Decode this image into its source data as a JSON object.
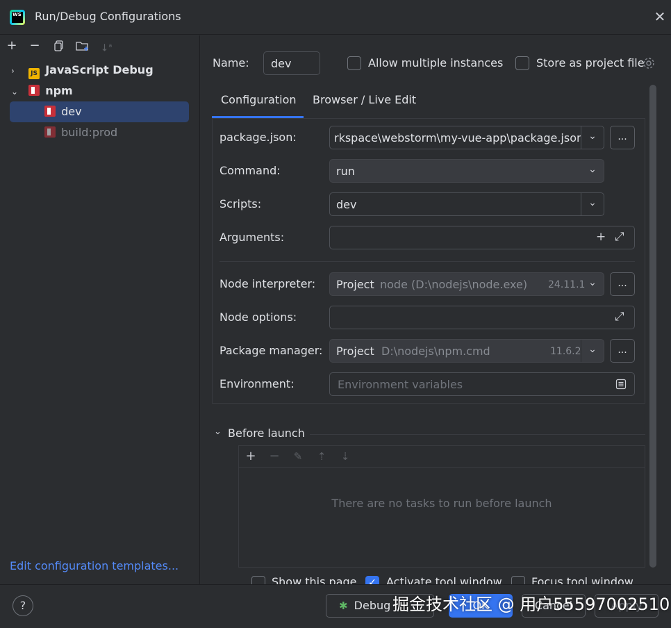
{
  "window": {
    "title": "Run/Debug Configurations",
    "app_icon_text": "WS"
  },
  "left_toolbar": {
    "add_icon": "+",
    "remove_icon": "−",
    "copy_icon": "copy-icon",
    "folder_icon": "folder-add-icon",
    "sort_icon": "sort-icon"
  },
  "tree": {
    "groups": [
      {
        "label": "JavaScript Debug",
        "badge": "JS",
        "expanded": false
      },
      {
        "label": "npm",
        "expanded": true,
        "children": [
          {
            "label": "dev",
            "selected": true
          },
          {
            "label": "build:prod",
            "selected": false
          }
        ]
      }
    ]
  },
  "edit_templates_link": "Edit configuration templates...",
  "header": {
    "name_label": "Name:",
    "name_value": "dev",
    "allow_multiple_label": "Allow multiple instances",
    "allow_multiple_checked": false,
    "store_project_label": "Store as project file",
    "store_project_checked": false
  },
  "tabs": [
    {
      "label": "Configuration",
      "active": true
    },
    {
      "label": "Browser / Live Edit",
      "active": false
    }
  ],
  "form": {
    "package_json_label": "package.json:",
    "package_json_value": "rkspace\\webstorm\\my-vue-app\\package.json",
    "command_label": "Command:",
    "command_value": "run",
    "scripts_label": "Scripts:",
    "scripts_value": "dev",
    "arguments_label": "Arguments:",
    "arguments_value": "",
    "node_interpreter_label": "Node interpreter:",
    "node_interpreter_prefix": "Project",
    "node_interpreter_path": "node (D:\\nodejs\\node.exe)",
    "node_interpreter_version": "24.11.1",
    "node_options_label": "Node options:",
    "node_options_value": "",
    "package_manager_label": "Package manager:",
    "package_manager_prefix": "Project",
    "package_manager_path": "D:\\nodejs\\npm.cmd",
    "package_manager_version": "11.6.2",
    "environment_label": "Environment:",
    "environment_placeholder": "Environment variables",
    "dots": "..."
  },
  "before_launch": {
    "title": "Before launch",
    "empty_text": "There are no tasks to run before launch"
  },
  "options": [
    {
      "label": "Show this page",
      "checked": false
    },
    {
      "label": "Activate tool window",
      "checked": true
    },
    {
      "label": "Focus tool window",
      "checked": false
    }
  ],
  "buttons": {
    "debug": "Debug",
    "ok": "OK",
    "cancel": "Cancel",
    "apply": "Apply",
    "help": "?"
  },
  "watermark": "掘金技术社区 @ 用户55597002510",
  "colors": {
    "background": "#2b2d30",
    "accent": "#3574f0",
    "link": "#548af7",
    "selection": "#2e436e"
  }
}
